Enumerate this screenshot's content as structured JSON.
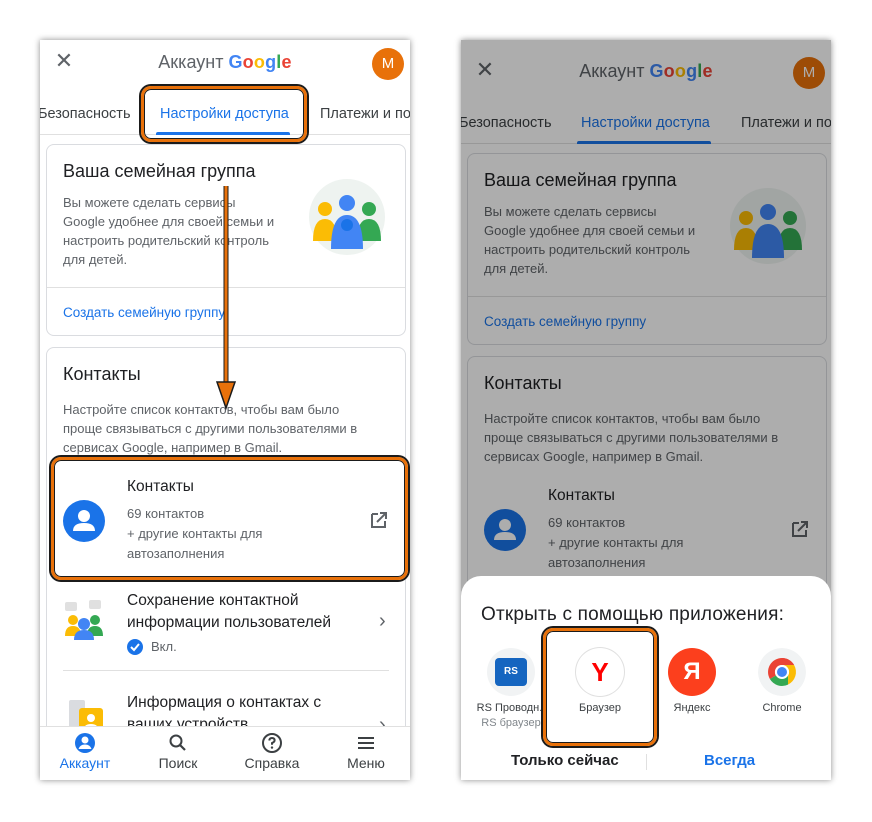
{
  "header": {
    "title_prefix": "Аккаунт",
    "title_brand": "Google",
    "avatar_letter": "M"
  },
  "tabs": [
    {
      "label": "Безопасность"
    },
    {
      "label": "Настройки доступа",
      "active": true
    },
    {
      "label": "Платежи и по"
    }
  ],
  "family_card": {
    "title": "Ваша семейная группа",
    "description": [
      "Вы можете сделать сервисы",
      "Google удобнее для своей семьи и",
      "настроить родительский контроль",
      "для детей."
    ],
    "link": "Создать семейную группу"
  },
  "contacts_card": {
    "title": "Контакты",
    "description": [
      "Настройте список контактов, чтобы вам было",
      "проще связываться с другими пользователями в",
      "сервисах Google, например в Gmail."
    ],
    "contacts_row": {
      "title": "Контакты",
      "count": "69 контактов",
      "extra_line1": "+ другие контакты для",
      "extra_line2": "автозаполнения"
    },
    "save_row": {
      "title_line1": "Сохранение контактной",
      "title_line2": "информации пользователей",
      "status": "Вкл."
    },
    "devices_row": {
      "title_line1": "Информация о контактах с",
      "title_line2": "ваших устройств"
    }
  },
  "bottom_nav": [
    {
      "label": "Аккаунт",
      "icon": "account-icon",
      "active": true
    },
    {
      "label": "Поиск",
      "icon": "search-icon"
    },
    {
      "label": "Справка",
      "icon": "help-icon"
    },
    {
      "label": "Меню",
      "icon": "menu-icon"
    }
  ],
  "open_with_sheet": {
    "title": "Открыть с помощью приложения:",
    "apps": [
      {
        "label": "RS Проводн..",
        "sublabel": "RS браузер",
        "icon": "rs-explorer-icon",
        "color": "#1565c0"
      },
      {
        "label": "Браузер",
        "icon": "yandex-browser-icon",
        "color": "#ff0000"
      },
      {
        "label": "Яндекс",
        "icon": "yandex-icon",
        "color": "#fc3f1d"
      },
      {
        "label": "Chrome",
        "icon": "chrome-icon"
      }
    ],
    "just_once": "Только сейчас",
    "always": "Всегда"
  },
  "colors": {
    "accent": "#1a73e8",
    "highlight": "#e8710a",
    "avatar": "#e8710a"
  }
}
